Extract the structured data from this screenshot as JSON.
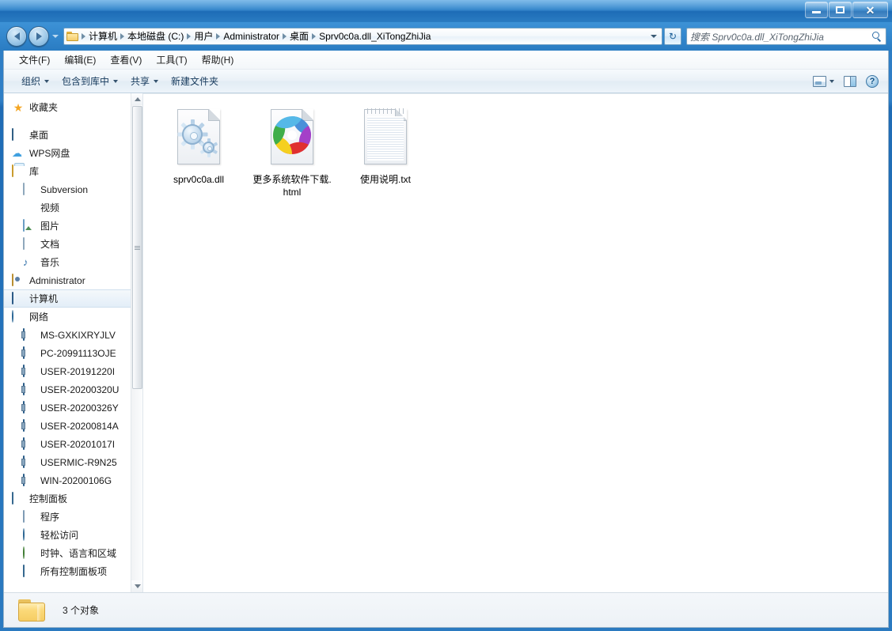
{
  "window": {
    "controls": {
      "minimize": "–",
      "maximize": "□",
      "close": "✕"
    }
  },
  "addressbar": {
    "folder_icon": "folder-icon",
    "breadcrumbs": [
      "计算机",
      "本地磁盘 (C:)",
      "用户",
      "Administrator",
      "桌面",
      "Sprv0c0a.dll_XiTongZhiJia"
    ],
    "dropdown_icon": "chevron-down-icon",
    "refresh_icon": "refresh-icon",
    "refresh_glyph": "↻"
  },
  "search": {
    "placeholder": "搜索 Sprv0c0a.dll_XiTongZhiJia",
    "icon": "search-icon"
  },
  "menubar": {
    "items": [
      {
        "label": "文件(F)"
      },
      {
        "label": "编辑(E)"
      },
      {
        "label": "查看(V)"
      },
      {
        "label": "工具(T)"
      },
      {
        "label": "帮助(H)"
      }
    ]
  },
  "toolbar": {
    "items": [
      {
        "label": "组织",
        "caret": true
      },
      {
        "label": "包含到库中",
        "caret": true
      },
      {
        "label": "共享",
        "caret": true
      },
      {
        "label": "新建文件夹",
        "caret": false
      }
    ],
    "views_icon": "change-view-icon",
    "views_caret": "chevron-down-icon",
    "preview_pane_icon": "preview-pane-icon",
    "help_icon": "help-icon",
    "help_glyph": "?"
  },
  "sidebar": {
    "items": [
      {
        "label": "收藏夹",
        "icon": "star-icon",
        "indent": 0,
        "selected": false
      },
      {
        "label": "桌面",
        "icon": "desktop-icon",
        "indent": 0,
        "selected": false
      },
      {
        "label": "WPS网盘",
        "icon": "cloud-icon",
        "indent": 1,
        "selected": false
      },
      {
        "label": "库",
        "icon": "library-icon",
        "indent": 1,
        "selected": false
      },
      {
        "label": "Subversion",
        "icon": "document-icon",
        "indent": 2,
        "selected": false
      },
      {
        "label": "视频",
        "icon": "video-icon",
        "indent": 2,
        "selected": false
      },
      {
        "label": "图片",
        "icon": "picture-icon",
        "indent": 2,
        "selected": false
      },
      {
        "label": "文档",
        "icon": "document-icon",
        "indent": 2,
        "selected": false
      },
      {
        "label": "音乐",
        "icon": "music-icon",
        "indent": 2,
        "selected": false
      },
      {
        "label": "Administrator",
        "icon": "user-icon",
        "indent": 1,
        "selected": false
      },
      {
        "label": "计算机",
        "icon": "computer-icon",
        "indent": 1,
        "selected": true
      },
      {
        "label": "网络",
        "icon": "network-icon",
        "indent": 1,
        "selected": false
      },
      {
        "label": "MS-GXKIXRYJLV",
        "icon": "network-computer-icon",
        "indent": 2,
        "selected": false
      },
      {
        "label": "PC-20991113OJE",
        "icon": "network-computer-icon",
        "indent": 2,
        "selected": false
      },
      {
        "label": "USER-20191220I",
        "icon": "network-computer-icon",
        "indent": 2,
        "selected": false
      },
      {
        "label": "USER-20200320U",
        "icon": "network-computer-icon",
        "indent": 2,
        "selected": false
      },
      {
        "label": "USER-20200326Y",
        "icon": "network-computer-icon",
        "indent": 2,
        "selected": false
      },
      {
        "label": "USER-20200814A",
        "icon": "network-computer-icon",
        "indent": 2,
        "selected": false
      },
      {
        "label": "USER-20201017I",
        "icon": "network-computer-icon",
        "indent": 2,
        "selected": false
      },
      {
        "label": "USERMIC-R9N25",
        "icon": "network-computer-icon",
        "indent": 2,
        "selected": false
      },
      {
        "label": "WIN-20200106G",
        "icon": "network-computer-icon",
        "indent": 2,
        "selected": false
      },
      {
        "label": "控制面板",
        "icon": "control-panel-icon",
        "indent": 1,
        "selected": false
      },
      {
        "label": "程序",
        "icon": "programs-icon",
        "indent": 2,
        "selected": false
      },
      {
        "label": "轻松访问",
        "icon": "ease-of-access-icon",
        "indent": 2,
        "selected": false
      },
      {
        "label": "时钟、语言和区域",
        "icon": "clock-language-region-icon",
        "indent": 2,
        "selected": false
      },
      {
        "label": "所有控制面板项",
        "icon": "control-panel-icon",
        "indent": 2,
        "selected": false
      }
    ],
    "scrollbar": {
      "up_arrow": "scroll-up-arrow",
      "down_arrow": "scroll-down-arrow"
    }
  },
  "files": [
    {
      "name": "sprv0c0a.dll",
      "icon": "dll-gears-icon",
      "type": "dll"
    },
    {
      "name": "更多系统软件下载.html",
      "icon": "browser-pinwheel-icon",
      "type": "html"
    },
    {
      "name": "使用说明.txt",
      "icon": "notepad-text-icon",
      "type": "txt"
    }
  ],
  "statusbar": {
    "folder_icon": "folder-large-icon",
    "text": "3 个对象"
  },
  "colors": {
    "titlebar_blue": "#2b80c8",
    "accent": "#3d92d6",
    "selection": "#e3eef8",
    "pinwheel": [
      "#4a90d9",
      "#a440c8",
      "#e03030",
      "#f5d020",
      "#3fae4a",
      "#55b8e8"
    ]
  }
}
